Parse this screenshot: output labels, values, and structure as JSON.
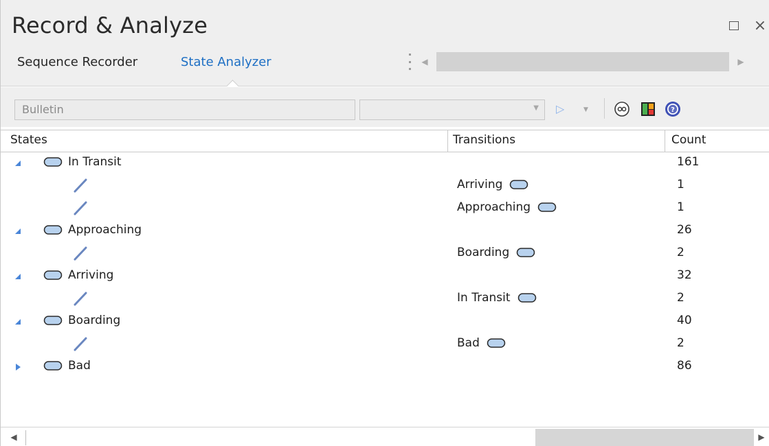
{
  "window": {
    "title": "Record & Analyze",
    "maximize_icon": "maximize-icon",
    "close_label": "×"
  },
  "tabs": [
    {
      "label": "Sequence Recorder",
      "active": false
    },
    {
      "label": "State Analyzer",
      "active": true
    }
  ],
  "toolbar": {
    "bulletin_value": "Bulletin",
    "combo_value": "",
    "play_glyph": "▷",
    "dropdown_glyph": "▼",
    "icons": [
      "link-icon",
      "layout-icon",
      "help-icon"
    ]
  },
  "grid": {
    "columns": [
      "States",
      "Transitions",
      "Count"
    ],
    "rows": [
      {
        "type": "state",
        "expanded": true,
        "state": "In Transit",
        "transition": "",
        "count": "161"
      },
      {
        "type": "transition",
        "state": "",
        "transition": "Arriving",
        "count": "1"
      },
      {
        "type": "transition",
        "state": "",
        "transition": "Approaching",
        "count": "1"
      },
      {
        "type": "state",
        "expanded": true,
        "state": "Approaching",
        "transition": "",
        "count": "26"
      },
      {
        "type": "transition",
        "state": "",
        "transition": "Boarding",
        "count": "2"
      },
      {
        "type": "state",
        "expanded": true,
        "state": "Arriving",
        "transition": "",
        "count": "32"
      },
      {
        "type": "transition",
        "state": "",
        "transition": "In Transit",
        "count": "2"
      },
      {
        "type": "state",
        "expanded": true,
        "state": "Boarding",
        "transition": "",
        "count": "40"
      },
      {
        "type": "transition",
        "state": "",
        "transition": "Bad",
        "count": "2"
      },
      {
        "type": "state",
        "expanded": false,
        "state": "Bad",
        "transition": "",
        "count": "86"
      }
    ]
  },
  "colors": {
    "accent": "#1e6fc4",
    "state_fill": "#b8d2ee",
    "state_stroke": "#2b2b2b",
    "expander": "#4a86d8",
    "transition_line": "#6a87c0"
  }
}
